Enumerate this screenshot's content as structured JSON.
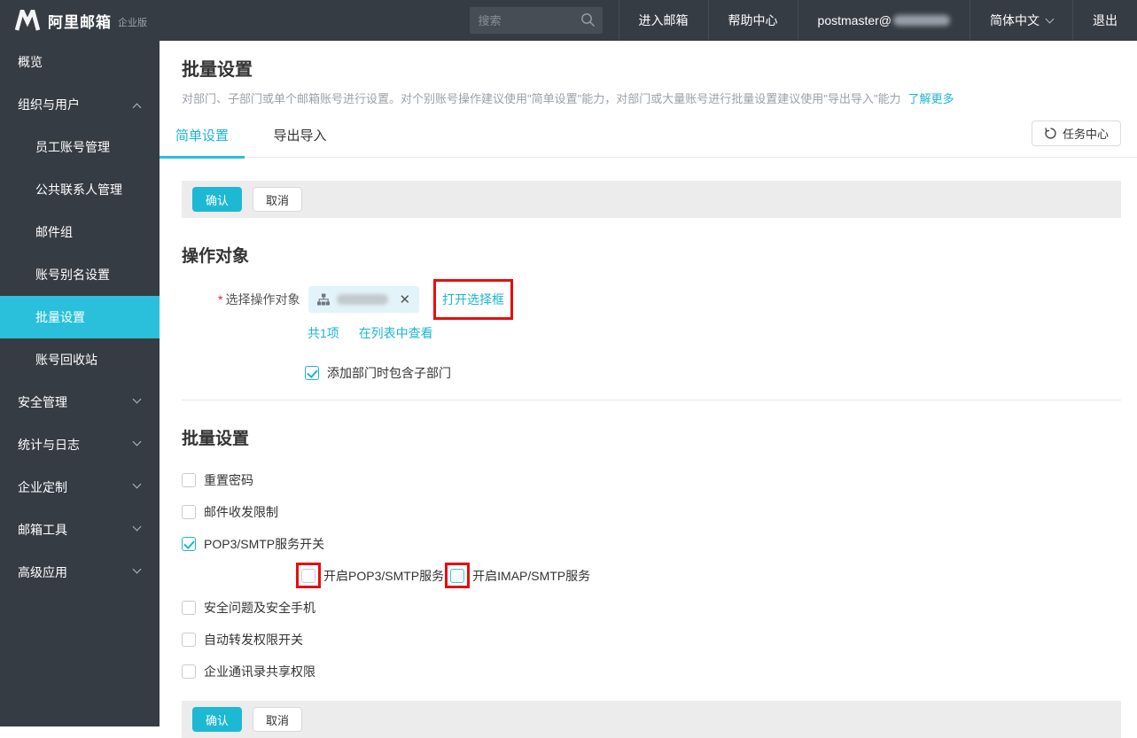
{
  "header": {
    "logo_text": "阿里邮箱",
    "logo_badge": "企业版",
    "search_placeholder": "搜索",
    "nav": {
      "enter_mailbox": "进入邮箱",
      "help_center": "帮助中心",
      "account_prefix": "postmaster@",
      "language": "简体中文",
      "logout": "退出"
    }
  },
  "sidebar": {
    "items": [
      {
        "label": "概览"
      },
      {
        "label": "组织与用户"
      },
      {
        "label": "员工账号管理"
      },
      {
        "label": "公共联系人管理"
      },
      {
        "label": "邮件组"
      },
      {
        "label": "账号别名设置"
      },
      {
        "label": "批量设置"
      },
      {
        "label": "账号回收站"
      },
      {
        "label": "安全管理"
      },
      {
        "label": "统计与日志"
      },
      {
        "label": "企业定制"
      },
      {
        "label": "邮箱工具"
      },
      {
        "label": "高级应用"
      }
    ]
  },
  "main": {
    "page_title": "批量设置",
    "page_desc": "对部门、子部门或单个邮箱账号进行设置。对个别账号操作建议使用\"简单设置\"能力，对部门或大量账号进行批量设置建议使用\"导出导入\"能力",
    "learn_more": "了解更多",
    "tabs": {
      "simple": "简单设置",
      "export_import": "导出导入"
    },
    "task_center": "任务中心",
    "actions": {
      "confirm": "确认",
      "cancel": "取消"
    },
    "target_section": {
      "title": "操作对象",
      "required_mark": "*",
      "select_label": "选择操作对象",
      "remove_icon": "✕",
      "open_selector": "打开选择框",
      "count_text": "共1项",
      "view_in_list": "在列表中查看",
      "include_sub": {
        "label": "添加部门时包含子部门",
        "checked": true
      }
    },
    "batch_section": {
      "title": "批量设置",
      "options": [
        {
          "label": "重置密码",
          "checked": false
        },
        {
          "label": "邮件收发限制",
          "checked": false
        },
        {
          "label": "POP3/SMTP服务开关",
          "checked": true
        },
        {
          "label": "安全问题及安全手机",
          "checked": false
        },
        {
          "label": "自动转发权限开关",
          "checked": false
        },
        {
          "label": "企业通讯录共享权限",
          "checked": false
        }
      ],
      "sub_options": [
        {
          "label": "开启POP3/SMTP服务",
          "checked": false
        },
        {
          "label": "开启IMAP/SMTP服务",
          "checked": false
        }
      ]
    }
  },
  "colors": {
    "accent": "#1db4d2",
    "sidebar_active": "#2ac0db",
    "annotation": "#e60e0e"
  }
}
